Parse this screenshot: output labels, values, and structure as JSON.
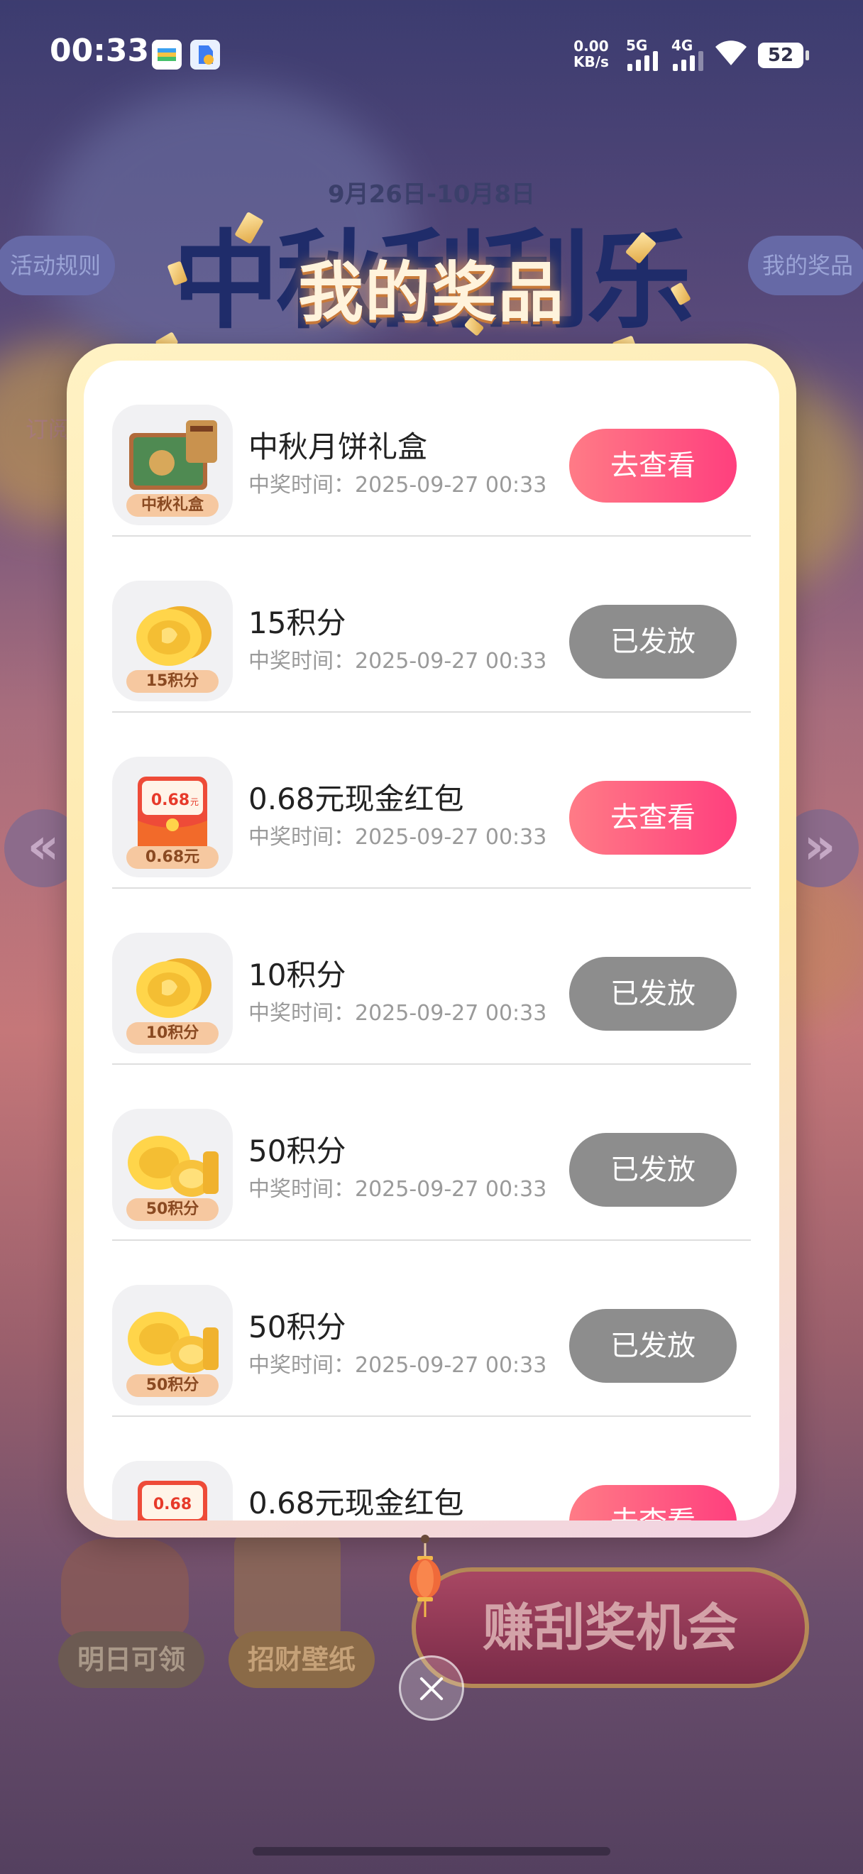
{
  "status_bar": {
    "time": "00:33",
    "net_rate_value": "0.00",
    "net_rate_unit": "KB/s",
    "sim1": "5G",
    "sim2": "4G",
    "battery": "52"
  },
  "background": {
    "date_range": "9月26日-10月8日",
    "headline": "中秋刮刮乐",
    "left_pill": "活动规则",
    "right_pill": "我的奖品",
    "left_note": "订阅",
    "bottom_left": "明日可领",
    "bottom_middle": "招财壁纸",
    "cta": "赚刮奖机会"
  },
  "modal": {
    "title": "我的奖品",
    "prizes": [
      {
        "name": "中秋月饼礼盒",
        "time_label": "中奖时间：",
        "time": "2025-09-27 00:33",
        "badge": "中秋礼盒",
        "action": "去查看",
        "state": "view"
      },
      {
        "name": "15积分",
        "time_label": "中奖时间：",
        "time": "2025-09-27 00:33",
        "badge": "15积分",
        "action": "已发放",
        "state": "issued"
      },
      {
        "name": "0.68元现金红包",
        "time_label": "中奖时间：",
        "time": "2025-09-27 00:33",
        "badge": "0.68元",
        "envelope_amount": "0.68",
        "envelope_unit": "元",
        "action": "去查看",
        "state": "view"
      },
      {
        "name": "10积分",
        "time_label": "中奖时间：",
        "time": "2025-09-27 00:33",
        "badge": "10积分",
        "action": "已发放",
        "state": "issued"
      },
      {
        "name": "50积分",
        "time_label": "中奖时间：",
        "time": "2025-09-27 00:33",
        "badge": "50积分",
        "action": "已发放",
        "state": "issued"
      },
      {
        "name": "50积分",
        "time_label": "中奖时间：",
        "time": "2025-09-27 00:33",
        "badge": "50积分",
        "action": "已发放",
        "state": "issued"
      },
      {
        "name": "0.68元现金红包",
        "envelope_amount": "0.68",
        "action": "去查看",
        "state": "view"
      }
    ]
  },
  "colors": {
    "view_button": "#ff4f80",
    "issued_button": "#8d8d8d",
    "badge_bg": "#f6c8a0"
  }
}
